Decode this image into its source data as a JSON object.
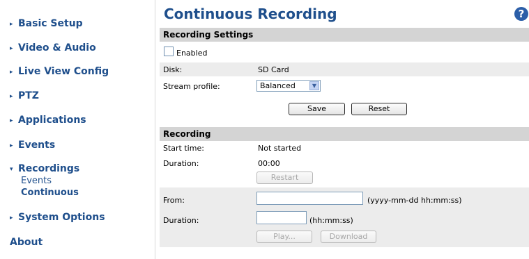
{
  "sidebar": {
    "items": [
      {
        "label": "Basic Setup",
        "arrow": "▸"
      },
      {
        "label": "Video & Audio",
        "arrow": "▸"
      },
      {
        "label": "Live View Config",
        "arrow": "▸"
      },
      {
        "label": "PTZ",
        "arrow": "▸"
      },
      {
        "label": "Applications",
        "arrow": "▸"
      },
      {
        "label": "Events",
        "arrow": "▸"
      },
      {
        "label": "Recordings",
        "arrow": "▾"
      },
      {
        "label": "System Options",
        "arrow": "▸"
      },
      {
        "label": "About",
        "arrow": ""
      }
    ],
    "sub_items": [
      {
        "label": "Events"
      },
      {
        "label": "Continuous"
      }
    ]
  },
  "page": {
    "title": "Continuous Recording",
    "help_icon": "?"
  },
  "recording_settings": {
    "heading": "Recording Settings",
    "enabled_label": "Enabled",
    "enabled_checked": false,
    "disk_label": "Disk:",
    "disk_value": "SD Card",
    "stream_profile_label": "Stream profile:",
    "stream_profile_value": "Balanced",
    "dropdown_icon": "▼",
    "save_label": "Save",
    "reset_label": "Reset"
  },
  "recording": {
    "heading": "Recording",
    "start_time_label": "Start time:",
    "start_time_value": "Not started",
    "duration_label": "Duration:",
    "duration_value": "00:00",
    "restart_label": "Restart",
    "from_label": "From:",
    "from_value": "",
    "from_hint": "(yyyy-mm-dd hh:mm:ss)",
    "duration2_label": "Duration:",
    "duration2_value": "",
    "duration2_hint": "(hh:mm:ss)",
    "play_label": "Play...",
    "download_label": "Download"
  }
}
